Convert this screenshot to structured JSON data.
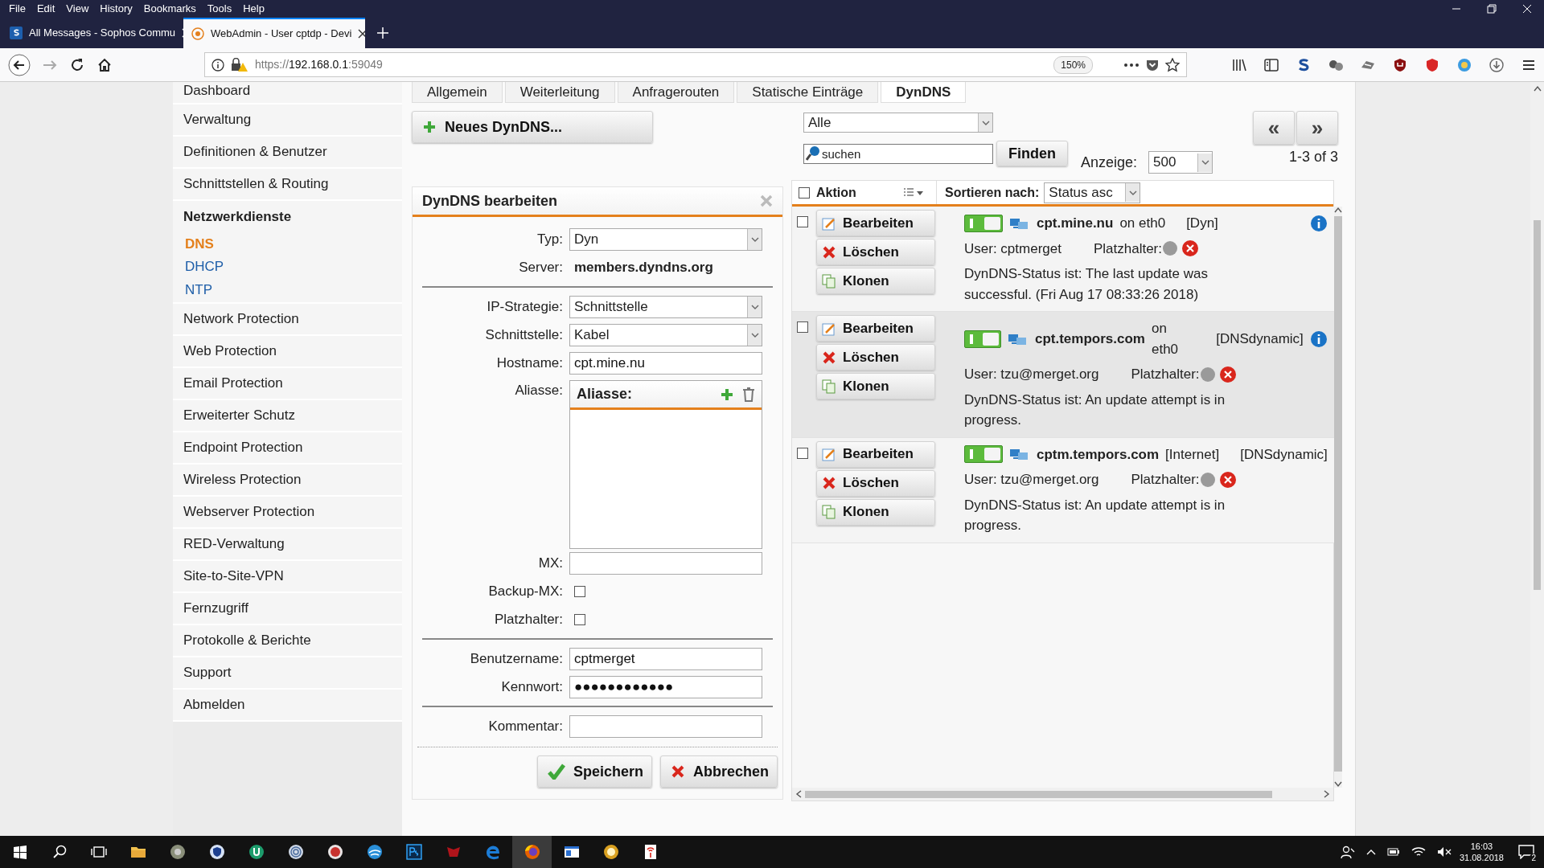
{
  "browser": {
    "menu": [
      "File",
      "Edit",
      "View",
      "History",
      "Bookmarks",
      "Tools",
      "Help"
    ],
    "tabs": [
      {
        "title": "All Messages - Sophos Commu",
        "selected": false,
        "kind": "sophos"
      },
      {
        "title": "WebAdmin - User cptdp - Devi",
        "selected": true,
        "kind": "webadmin"
      }
    ],
    "url": {
      "scheme": "https://",
      "host": "192.168.0.1",
      "port": ":59049"
    },
    "zoom": "150%"
  },
  "sidebar": {
    "items": [
      {
        "label": "Dashboard",
        "selected": false,
        "expanded": false
      },
      {
        "label": "Verwaltung",
        "selected": false,
        "expanded": false
      },
      {
        "label": "Definitionen & Benutzer",
        "selected": false,
        "expanded": false
      },
      {
        "label": "Schnittstellen & Routing",
        "selected": false,
        "expanded": false
      },
      {
        "label": "Netzwerkdienste",
        "selected": false,
        "expanded": true,
        "children": [
          {
            "label": "DNS",
            "selected": true
          },
          {
            "label": "DHCP",
            "selected": false
          },
          {
            "label": "NTP",
            "selected": false
          }
        ]
      },
      {
        "label": "Network Protection",
        "selected": false,
        "expanded": false
      },
      {
        "label": "Web Protection",
        "selected": false,
        "expanded": false
      },
      {
        "label": "Email Protection",
        "selected": false,
        "expanded": false
      },
      {
        "label": "Erweiterter Schutz",
        "selected": false,
        "expanded": false
      },
      {
        "label": "Endpoint Protection",
        "selected": false,
        "expanded": false
      },
      {
        "label": "Wireless Protection",
        "selected": false,
        "expanded": false
      },
      {
        "label": "Webserver Protection",
        "selected": false,
        "expanded": false
      },
      {
        "label": "RED-Verwaltung",
        "selected": false,
        "expanded": false
      },
      {
        "label": "Site-to-Site-VPN",
        "selected": false,
        "expanded": false
      },
      {
        "label": "Fernzugriff",
        "selected": false,
        "expanded": false
      },
      {
        "label": "Protokolle & Berichte",
        "selected": false,
        "expanded": false
      },
      {
        "label": "Support",
        "selected": false,
        "expanded": false
      },
      {
        "label": "Abmelden",
        "selected": false,
        "expanded": false
      }
    ]
  },
  "page_tabs": [
    {
      "label": "Allgemein",
      "selected": false
    },
    {
      "label": "Weiterleitung",
      "selected": false
    },
    {
      "label": "Anfragerouten",
      "selected": false
    },
    {
      "label": "Statische Einträge",
      "selected": false
    },
    {
      "label": "DynDNS",
      "selected": true
    }
  ],
  "new_button": "Neues DynDNS...",
  "filter": {
    "value": "Alle"
  },
  "search": {
    "placeholder": "suchen",
    "button": "Finden"
  },
  "display": {
    "label": "Anzeige:",
    "value": "500"
  },
  "pager": {
    "prev": "«",
    "next": "»",
    "range": "1-3 of 3"
  },
  "editor": {
    "title": "DynDNS bearbeiten",
    "fields": [
      {
        "kind": "select",
        "label": "Typ:",
        "value": "Dyn"
      },
      {
        "kind": "static",
        "label": "Server:",
        "value": "members.dyndns.org"
      },
      {
        "kind": "divider"
      },
      {
        "kind": "select",
        "label": "IP-Strategie:",
        "value": "Schnittstelle"
      },
      {
        "kind": "select",
        "label": "Schnittstelle:",
        "value": "Kabel"
      },
      {
        "kind": "text",
        "label": "Hostname:",
        "value": "cpt.mine.nu"
      },
      {
        "kind": "aliases",
        "label": "Aliasse:",
        "header": "Aliasse:"
      },
      {
        "kind": "text",
        "label": "MX:"
      },
      {
        "kind": "checkbox",
        "label": "Backup-MX:",
        "checked": false
      },
      {
        "kind": "checkbox",
        "label": "Platzhalter:",
        "checked": false
      },
      {
        "kind": "divider"
      },
      {
        "kind": "text",
        "label": "Benutzername:",
        "value": "cptmerget"
      },
      {
        "kind": "text",
        "label": "Kennwort:",
        "value": "●●●●●●●●●●●●"
      },
      {
        "kind": "divider"
      },
      {
        "kind": "text",
        "label": "Kommentar:"
      }
    ],
    "save": "Speichern",
    "cancel": "Abbrechen"
  },
  "list": {
    "select_all": false,
    "action_label": "Aktion",
    "sort_label": "Sortieren nach:",
    "sort_value": "Status asc",
    "entries": [
      {
        "checked": false,
        "highlighted": false,
        "enabled": true,
        "info": true,
        "actions": [
          "Bearbeiten",
          "Löschen",
          "Klonen"
        ],
        "host": "cpt.mine.nu",
        "iface": "on eth0",
        "provider": "[Dyn]",
        "user": "User: cptmerget",
        "wildcard_label": "Platzhalter:",
        "status": "DynDNS-Status ist: The last update was successful. (Fri Aug 17 08:33:26 2018)"
      },
      {
        "checked": false,
        "highlighted": true,
        "enabled": true,
        "info": true,
        "actions": [
          "Bearbeiten",
          "Löschen",
          "Klonen"
        ],
        "host": "cpt.tempors.com",
        "iface": "on eth0",
        "provider": "[DNSdynamic]",
        "user": "User: tzu@merget.org",
        "wildcard_label": "Platzhalter:",
        "status": "DynDNS-Status ist: An update attempt is in progress."
      },
      {
        "checked": false,
        "highlighted": false,
        "enabled": true,
        "info": false,
        "actions": [
          "Bearbeiten",
          "Löschen",
          "Klonen"
        ],
        "host": "cptm.tempors.com",
        "iface": "[Internet]",
        "provider": "[DNSdynamic]",
        "user": "User: tzu@merget.org",
        "wildcard_label": "Platzhalter:",
        "status": "DynDNS-Status ist: An update attempt is in progress."
      }
    ]
  },
  "taskbar": {
    "apps": [
      {
        "kind": "folder",
        "selected": false
      },
      {
        "kind": "gray",
        "selected": false
      },
      {
        "kind": "shield",
        "selected": false
      },
      {
        "kind": "green",
        "selected": false
      },
      {
        "kind": "ring",
        "selected": false
      },
      {
        "kind": "red",
        "selected": false
      },
      {
        "kind": "swirl",
        "selected": false
      },
      {
        "kind": "ps",
        "selected": false
      },
      {
        "kind": "game",
        "selected": false
      },
      {
        "kind": "edge",
        "selected": false
      },
      {
        "kind": "firefox",
        "selected": true
      },
      {
        "kind": "window",
        "selected": false
      },
      {
        "kind": "zoom",
        "selected": false
      },
      {
        "kind": "tower",
        "selected": false
      }
    ],
    "time": "16:03",
    "date": "31.08.2018",
    "notifications": "2"
  }
}
